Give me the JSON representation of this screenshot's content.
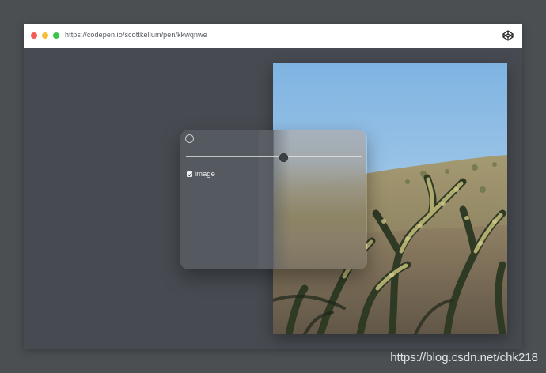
{
  "browser": {
    "url": "https://codepen.io/scottkellum/pen/kkwqnwe",
    "icon": "codepen-icon",
    "dots": {
      "close": "#f65a55",
      "minimize": "#f7be3b",
      "maximize": "#3bc44a"
    }
  },
  "panel": {
    "slider_value": 0.55,
    "checkbox_label": "image",
    "checkbox_checked": true
  },
  "watermark": "https://blog.csdn.net/chk218",
  "colors": {
    "page_background": "#4b4f52",
    "window_background": "#474b51",
    "sky": "#8fbfe6"
  }
}
